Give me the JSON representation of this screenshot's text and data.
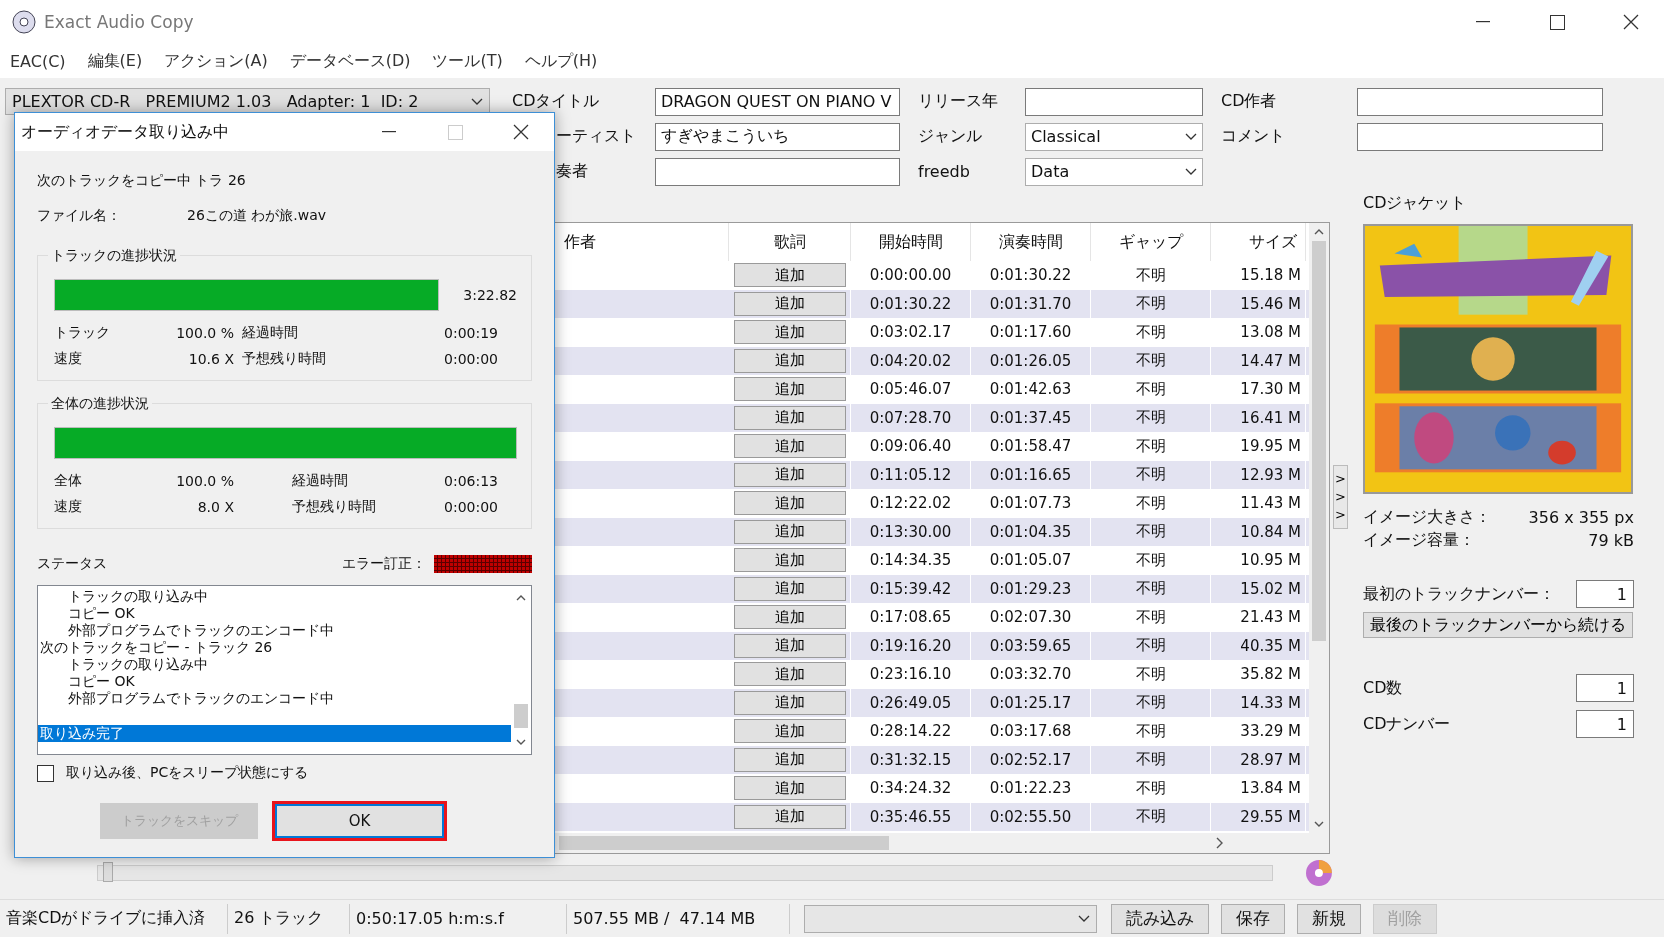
{
  "window": {
    "title": "Exact Audio Copy"
  },
  "menu": [
    "EAC(C)",
    "編集(E)",
    "アクション(A)",
    "データベース(D)",
    "ツール(T)",
    "ヘルプ(H)"
  ],
  "drive": {
    "value": "PLEXTOR CD-R   PREMIUM2 1.03   Adapter: 1  ID: 2"
  },
  "form": [
    {
      "label": "CDタイトル",
      "value": "DRAGON QUEST ON PIANO V",
      "kind": "text"
    },
    {
      "label": "リリース年",
      "kind": "text"
    },
    {
      "label": "CD作者",
      "kind": "text"
    },
    {
      "label": "ーティスト",
      "value": "すぎやまこういち",
      "kind": "text"
    },
    {
      "label": "ジャンル",
      "value": "Classical",
      "kind": "select"
    },
    {
      "label": "コメント",
      "kind": "text"
    },
    {
      "label": "奏者",
      "kind": "text"
    },
    {
      "label": "freedb",
      "value": "Data",
      "kind": "select"
    }
  ],
  "position_slider": {
    "level": 0.0
  },
  "table": {
    "columns": [
      "作者",
      "歌詞",
      "開始時間",
      "演奏時間",
      "ギャップ",
      "サイズ"
    ],
    "rows": [
      {
        "lyrics": "追加",
        "start": "0:00:00.00",
        "length": "0:01:30.22",
        "gap": "不明",
        "size": "15.18 M"
      },
      {
        "lyrics": "追加",
        "start": "0:01:30.22",
        "length": "0:01:31.70",
        "gap": "不明",
        "size": "15.46 M"
      },
      {
        "lyrics": "追加",
        "start": "0:03:02.17",
        "length": "0:01:17.60",
        "gap": "不明",
        "size": "13.08 M"
      },
      {
        "lyrics": "追加",
        "start": "0:04:20.02",
        "length": "0:01:26.05",
        "gap": "不明",
        "size": "14.47 M"
      },
      {
        "lyrics": "追加",
        "start": "0:05:46.07",
        "length": "0:01:42.63",
        "gap": "不明",
        "size": "17.30 M"
      },
      {
        "lyrics": "追加",
        "start": "0:07:28.70",
        "length": "0:01:37.45",
        "gap": "不明",
        "size": "16.41 M"
      },
      {
        "lyrics": "追加",
        "start": "0:09:06.40",
        "length": "0:01:58.47",
        "gap": "不明",
        "size": "19.95 M"
      },
      {
        "lyrics": "追加",
        "start": "0:11:05.12",
        "length": "0:01:16.65",
        "gap": "不明",
        "size": "12.93 M"
      },
      {
        "lyrics": "追加",
        "start": "0:12:22.02",
        "length": "0:01:07.73",
        "gap": "不明",
        "size": "11.43 M"
      },
      {
        "lyrics": "追加",
        "start": "0:13:30.00",
        "length": "0:01:04.35",
        "gap": "不明",
        "size": "10.84 M"
      },
      {
        "lyrics": "追加",
        "start": "0:14:34.35",
        "length": "0:01:05.07",
        "gap": "不明",
        "size": "10.95 M"
      },
      {
        "lyrics": "追加",
        "start": "0:15:39.42",
        "length": "0:01:29.23",
        "gap": "不明",
        "size": "15.02 M"
      },
      {
        "lyrics": "追加",
        "start": "0:17:08.65",
        "length": "0:02:07.30",
        "gap": "不明",
        "size": "21.43 M"
      },
      {
        "lyrics": "追加",
        "start": "0:19:16.20",
        "length": "0:03:59.65",
        "gap": "不明",
        "size": "40.35 M"
      },
      {
        "lyrics": "追加",
        "start": "0:23:16.10",
        "length": "0:03:32.70",
        "gap": "不明",
        "size": "35.82 M"
      },
      {
        "lyrics": "追加",
        "start": "0:26:49.05",
        "length": "0:01:25.17",
        "gap": "不明",
        "size": "14.33 M"
      },
      {
        "lyrics": "追加",
        "start": "0:28:14.22",
        "length": "0:03:17.68",
        "gap": "不明",
        "size": "33.29 M"
      },
      {
        "lyrics": "追加",
        "start": "0:31:32.15",
        "length": "0:02:52.17",
        "gap": "不明",
        "size": "28.97 M"
      },
      {
        "lyrics": "追加",
        "start": "0:34:24.32",
        "length": "0:01:22.23",
        "gap": "不明",
        "size": "13.84 M"
      },
      {
        "lyrics": "追加",
        "start": "0:35:46.55",
        "length": "0:02:55.50",
        "gap": "不明",
        "size": "29.55 M"
      }
    ]
  },
  "side_panel": {
    "cover_label": "CDジャケット",
    "cover": {
      "kind": "picture"
    },
    "info": [
      {
        "label": "イメージ大きさ：",
        "value": "356 x 355 px"
      },
      {
        "label": "イメージ容量：",
        "value": "79 kB"
      }
    ],
    "first_track": {
      "label": "最初のトラックナンバー：",
      "value": "1"
    },
    "continue_button": "最後のトラックナンバーから続ける",
    "cd_count": {
      "label": "CD数",
      "value": "1"
    },
    "cd_number": {
      "label": "CDナンバー",
      "value": "1"
    },
    "toggle": [
      ">",
      ">",
      ">"
    ]
  },
  "status_bar": {
    "cells": [
      "音楽CDがドライブに挿入済",
      "26 トラック",
      "0:50:17.05 h:m:s.f",
      "507.55 MB /  47.14 MB"
    ],
    "buttons": [
      {
        "label": "読み込み",
        "disabled": false
      },
      {
        "label": "保存",
        "disabled": false
      },
      {
        "label": "新規",
        "disabled": false
      },
      {
        "label": "削除",
        "disabled": true
      }
    ]
  },
  "dialog": {
    "title": "オーディオデータ取り込み中",
    "current": "次のトラックをコピー中 トラ 26",
    "file_label": "ファイル名：",
    "file_name": "26この道 わが旅.wav",
    "groups": [
      {
        "title": "トラックの進捗状況",
        "level": 1.0,
        "time": "3:22.82",
        "rows": [
          {
            "label": "トラック",
            "value": "100.0 %",
            "label2": "経過時間",
            "value2": "0:00:19"
          },
          {
            "label": "速度",
            "value": "10.6 X",
            "label2": "予想残り時間",
            "value2": "0:00:00"
          }
        ]
      },
      {
        "title": "全体の進捗状況",
        "level": 1.0,
        "rows": [
          {
            "label": "全体",
            "value": "100.0 %",
            "label2": "経過時間",
            "value2": "0:06:13"
          },
          {
            "label": "速度",
            "value": "8.0 X",
            "label2": "予想残り時間",
            "value2": "0:00:00"
          }
        ]
      }
    ],
    "status_label": "ステータス",
    "error_label": "エラー訂正：",
    "log": [
      {
        "children": [
          {
            "text": "トラックの取り込み中",
            "selected": false
          },
          {
            "text": "コピー OK",
            "selected": false
          },
          {
            "text": "外部プログラムでトラックのエンコード中",
            "selected": false
          }
        ]
      },
      {
        "text": "次のトラックをコピー - トラック 26",
        "selected": false,
        "children": [
          {
            "text": "トラックの取り込み中",
            "selected": false
          },
          {
            "text": "コピー OK",
            "selected": false
          },
          {
            "text": "外部プログラムでトラックのエンコード中",
            "selected": false
          }
        ]
      },
      {
        "text": "取り込み完了",
        "selected": true
      }
    ],
    "sleep": {
      "label": "取り込み後、PCをスリープ状態にする",
      "checked": false
    },
    "buttons": [
      {
        "label": "トラックをスキップ",
        "disabled": true,
        "highlighted": false
      },
      {
        "label": "OK",
        "disabled": false,
        "highlighted": true
      }
    ]
  }
}
